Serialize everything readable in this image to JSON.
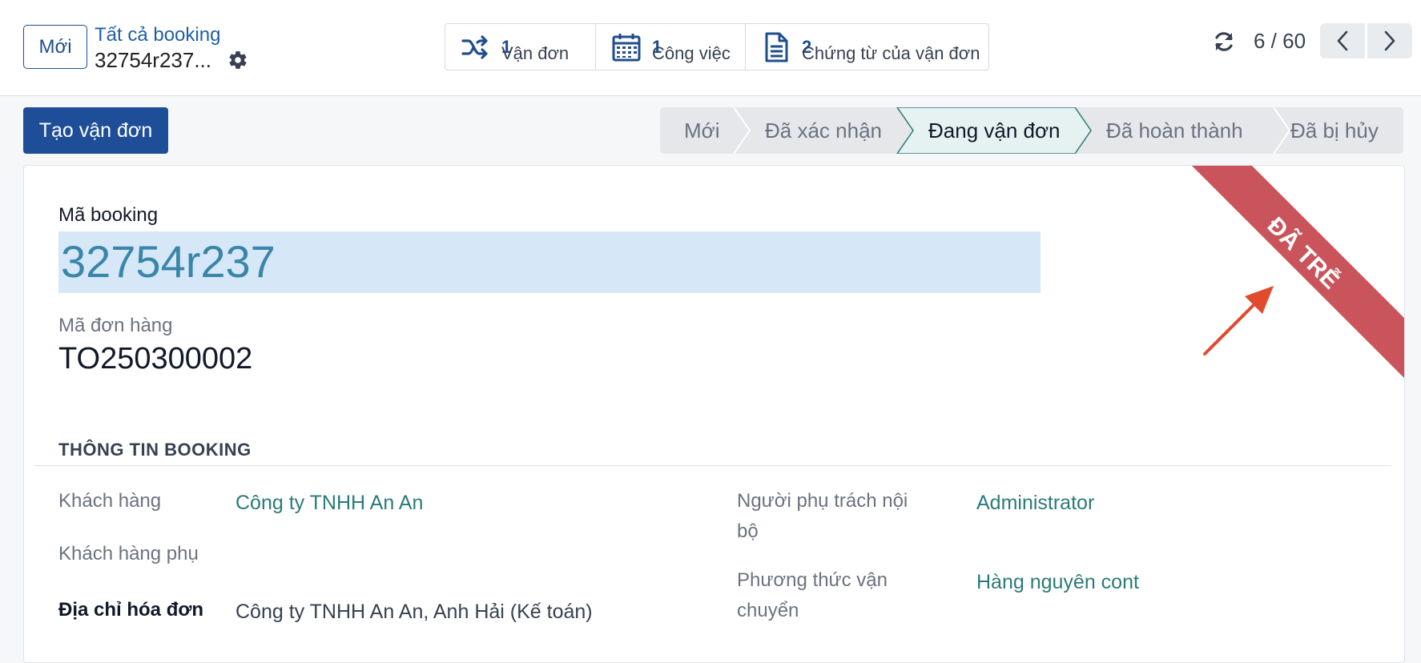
{
  "control_panel": {
    "new_button": "Mới",
    "breadcrumb_parent": "Tất cả booking",
    "breadcrumb_current": "32754r237...",
    "smart_buttons": [
      {
        "label": "Vận đơn",
        "count": "1",
        "icon": "shuffle-icon"
      },
      {
        "label": "Công việc",
        "count": "1",
        "icon": "calendar-icon"
      },
      {
        "label": "Chứng từ của vận đơn",
        "count": "2",
        "icon": "document-icon"
      }
    ],
    "pager": "6 / 60"
  },
  "statusbar": {
    "create_button": "Tạo vận đơn",
    "stages": [
      "Mới",
      "Đã xác nhận",
      "Đang vận đơn",
      "Đã hoàn thành",
      "Đã bị hủy"
    ],
    "active_stage": "Đang vận đơn"
  },
  "form": {
    "ribbon": "ĐÃ TRỄ",
    "ribbon_color": "#c9545b",
    "booking_code_label": "Mã booking",
    "booking_code": "32754r237",
    "order_code_label": "Mã đơn hàng",
    "order_code": "TO250300002",
    "section_title": "THÔNG TIN BOOKING",
    "left_fields": [
      {
        "label": "Khách hàng",
        "value": "Công ty TNHH An An"
      },
      {
        "label": "Khách hàng phụ",
        "value": ""
      },
      {
        "label": "Địa chỉ hóa đơn",
        "value": "Công ty TNHH An An, Anh Hải (Kế toán)"
      }
    ],
    "right_fields": [
      {
        "label_line1": "Người phụ trách nội",
        "label_line2": "bộ",
        "value": "Administrator"
      },
      {
        "label_line1": "Phương thức vận",
        "label_line2": "chuyển",
        "value": "Hàng nguyên cont"
      }
    ]
  }
}
